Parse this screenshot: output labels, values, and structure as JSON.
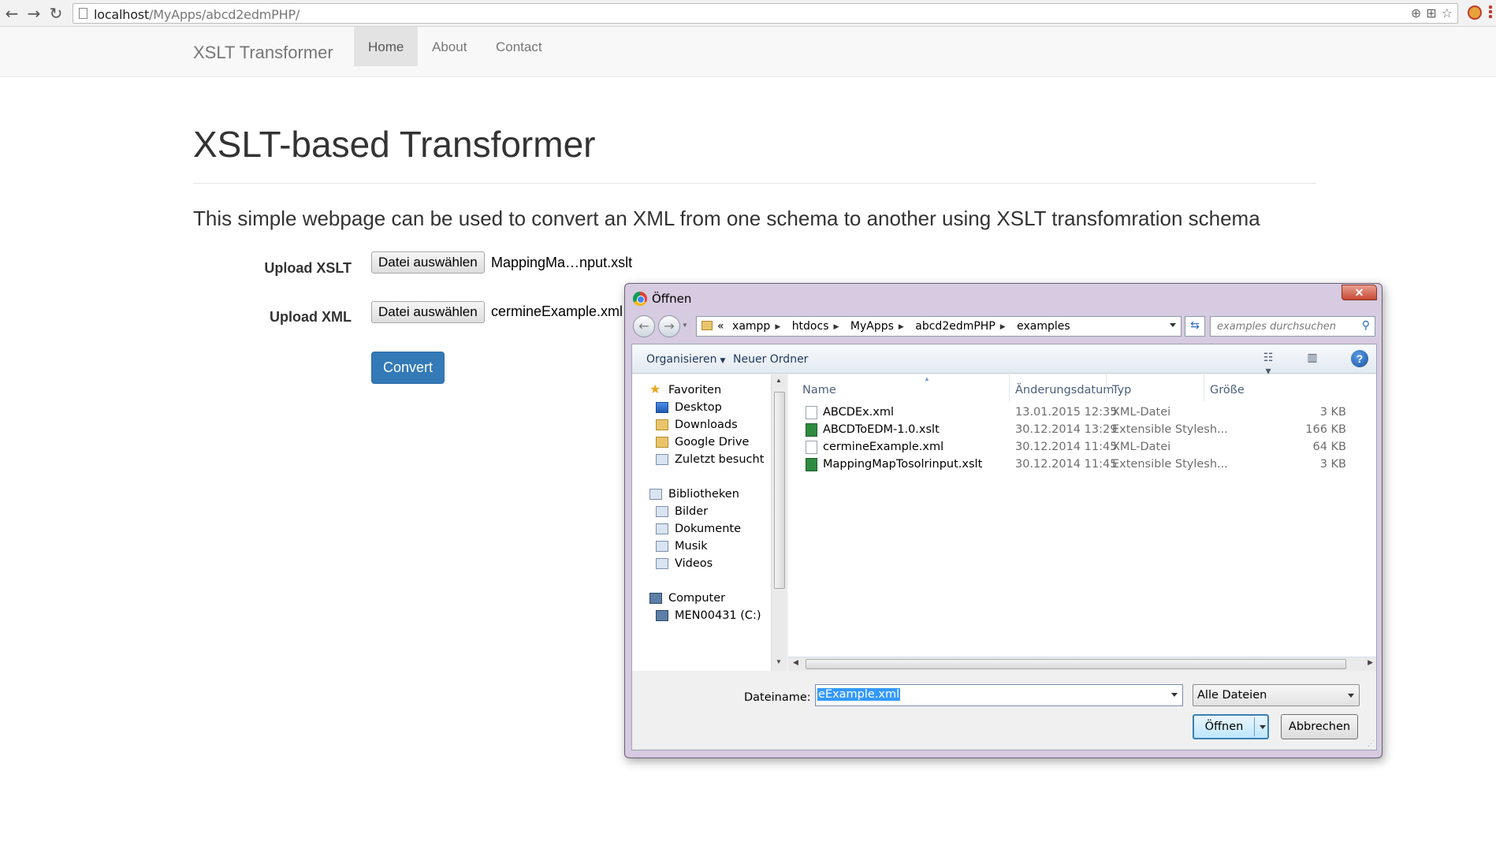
{
  "browser": {
    "back_icon": "back-arrow-icon",
    "forward_icon": "forward-arrow-icon",
    "reload_icon": "reload-icon",
    "url_host": "localhost",
    "url_path": "/MyApps/abcd2edmPHP/"
  },
  "navbar": {
    "brand": "XSLT Transformer",
    "items": [
      {
        "label": "Home",
        "active": true
      },
      {
        "label": "About",
        "active": false
      },
      {
        "label": "Contact",
        "active": false
      }
    ]
  },
  "main": {
    "title": "XSLT-based Transformer",
    "lead": "This simple webpage can be used to convert an XML from one schema to another using XSLT transfomration schema",
    "xslt_label": "Upload XSLT",
    "xslt_button": "Datei auswählen",
    "xslt_file": "MappingMa…nput.xslt",
    "xml_label": "Upload XML",
    "xml_button": "Datei auswählen",
    "xml_file": "cermineExample.xml",
    "convert_button": "Convert",
    "accent_color": "#337ab7"
  },
  "dialog": {
    "title": "Öffnen",
    "close": "✕",
    "breadcrumb": [
      "xampp",
      "htdocs",
      "MyApps",
      "abcd2edmPHP",
      "examples"
    ],
    "search_placeholder": "examples durchsuchen",
    "toolbar": {
      "organize": "Organisieren",
      "new_folder": "Neuer Ordner"
    },
    "nav": {
      "favorites_header": "Favoriten",
      "favorites": [
        "Desktop",
        "Downloads",
        "Google Drive",
        "Zuletzt besucht"
      ],
      "libraries_header": "Bibliotheken",
      "libraries": [
        "Bilder",
        "Dokumente",
        "Musik",
        "Videos"
      ],
      "computer_header": "Computer",
      "drive": "MEN00431 (C:)"
    },
    "columns": {
      "name": "Name",
      "date": "Änderungsdatum",
      "type": "Typ",
      "size": "Größe"
    },
    "files": [
      {
        "name": "ABCDEx.xml",
        "date": "13.01.2015 12:35",
        "type": "XML-Datei",
        "size": "3 KB",
        "kind": "xml"
      },
      {
        "name": "ABCDToEDM-1.0.xslt",
        "date": "30.12.2014 13:29",
        "type": "Extensible Stylesh...",
        "size": "166 KB",
        "kind": "xslt"
      },
      {
        "name": "cermineExample.xml",
        "date": "30.12.2014 11:45",
        "type": "XML-Datei",
        "size": "64 KB",
        "kind": "xml"
      },
      {
        "name": "MappingMapTosolrinput.xslt",
        "date": "30.12.2014 11:45",
        "type": "Extensible Stylesh...",
        "size": "3 KB",
        "kind": "xslt"
      }
    ],
    "filename_label": "Dateiname:",
    "filename_value": "eExample.xml",
    "filter_value": "Alle Dateien",
    "open_button": "Öffnen",
    "cancel_button": "Abbrechen"
  }
}
